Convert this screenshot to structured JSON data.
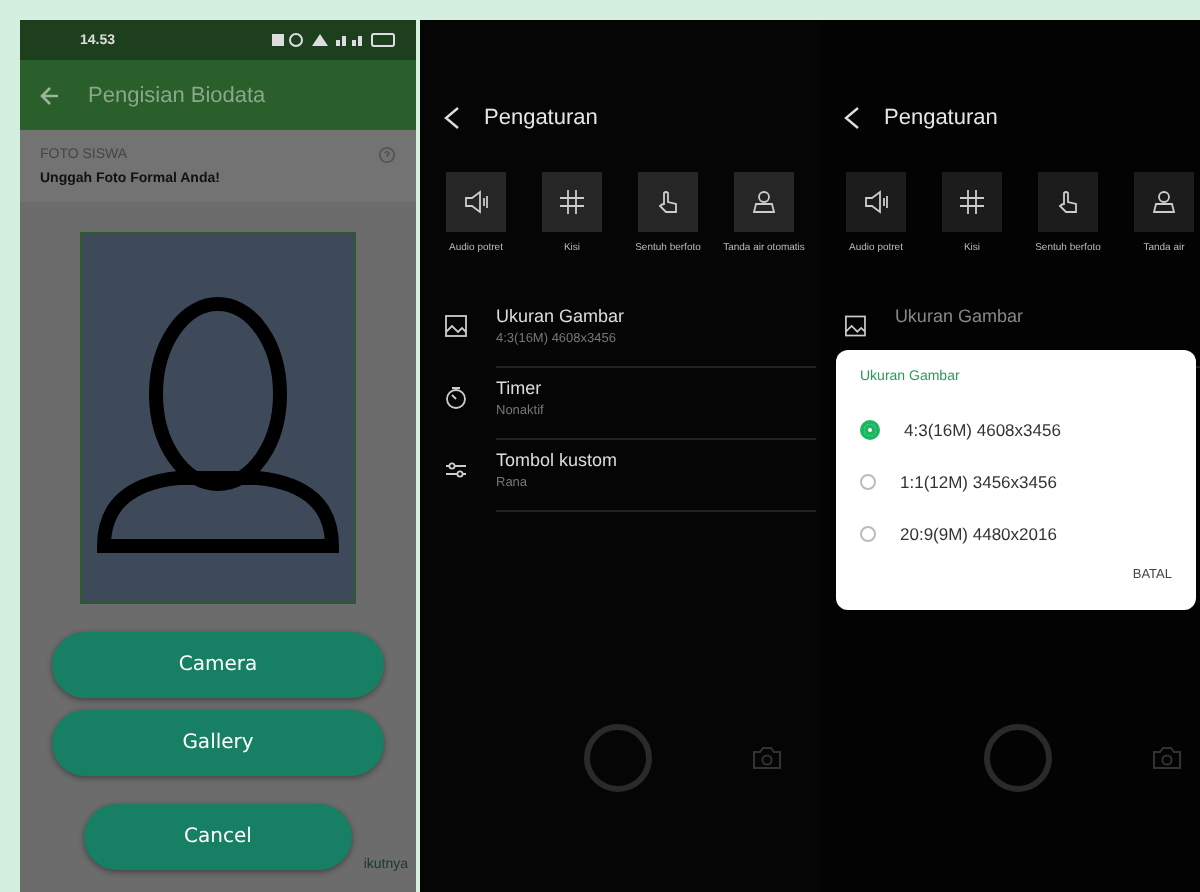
{
  "form_screen": {
    "status_bar": {
      "time": "14.53"
    },
    "app_bar": {
      "title": "Pengisian Biodata"
    },
    "section": {
      "title": "FOTO SISWA",
      "instruction": "Unggah Foto Formal Anda!"
    },
    "sheet_buttons": [
      "Camera",
      "Gallery",
      "Cancel"
    ],
    "footer_text": "ikutnya"
  },
  "settings_screen": {
    "title": "Pengaturan",
    "quick_settings": [
      {
        "label": "Audio potret"
      },
      {
        "label": "Kisi"
      },
      {
        "label": "Sentuh berfoto"
      },
      {
        "label": "Tanda air otomatis"
      }
    ],
    "items": [
      {
        "title": "Ukuran Gambar",
        "value": "4:3(16M) 4608x3456"
      },
      {
        "title": "Timer",
        "value": "Nonaktif"
      },
      {
        "title": "Tombol kustom",
        "value": "Rana"
      }
    ]
  },
  "settings_dialog_screen": {
    "title": "Pengaturan",
    "quick_settings": [
      {
        "label": "Audio potret"
      },
      {
        "label": "Kisi"
      },
      {
        "label": "Sentuh berfoto"
      },
      {
        "label": "Tanda air"
      }
    ],
    "items": [
      {
        "title": "Ukuran Gambar"
      }
    ],
    "dialog": {
      "title": "Ukuran Gambar",
      "options": [
        {
          "label": "4:3(16M) 4608x3456",
          "selected": true
        },
        {
          "label": "1:1(12M) 3456x3456",
          "selected": false
        },
        {
          "label": "20:9(9M) 4480x2016",
          "selected": false
        }
      ],
      "cancel": "BATAL"
    }
  }
}
